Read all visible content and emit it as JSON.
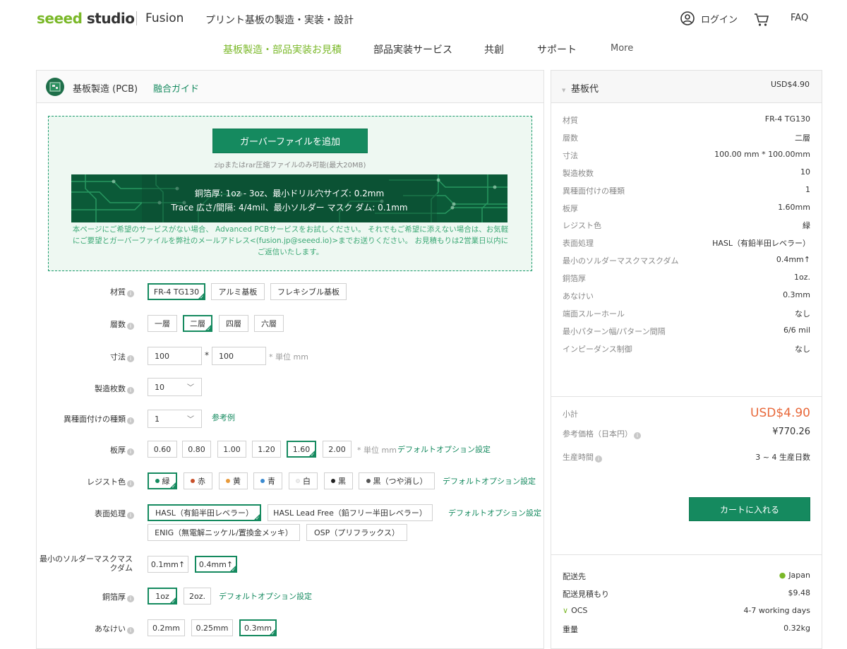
{
  "header": {
    "logo_seeed": "seeed",
    "logo_studio": "studio",
    "fusion": "Fusion",
    "tagline": "プリント基板の製造・実装・設計",
    "login": "ログイン",
    "faq": "FAQ"
  },
  "nav": {
    "items": [
      "基板製造・部品実装お見積",
      "部品実装サービス",
      "共創",
      "サポート",
      "More"
    ]
  },
  "form": {
    "title": "基板製造 (PCB)",
    "guide_link": "融合ガイド",
    "upload_button": "ガーバーファイルを追加",
    "upload_hint": "zipまたはrar圧縮ファイルのみ可能(最大20MB)",
    "banner_line1": "銅箔厚: 1oz - 3oz、最小ドリル穴サイズ: 0.2mm",
    "banner_line2": "Trace 広さ/間隔: 4/4mil、最小ソルダー マスク ダム: 0.1mm",
    "notice": "本ページにご希望のサービスがない場合、 Advanced PCBサービスをお試しください。 それでもご希望に添えない場合は、お気軽にご要望とガーバーファイルを弊社のメールアドレス<(fusion.jp@seeed.io)>までお送りください。 お見積もりは2営業日以内にご返信いたします。",
    "material": {
      "label": "材質",
      "options": [
        "FR-4 TG130",
        "アルミ基板",
        "フレキシブル基板"
      ]
    },
    "layers": {
      "label": "層数",
      "options": [
        "一層",
        "二層",
        "四層",
        "六層"
      ]
    },
    "size": {
      "label": "寸法",
      "w": "100",
      "h": "100",
      "sep": "*",
      "unit": "* 単位 mm"
    },
    "qty": {
      "label": "製造枚数",
      "value": "10"
    },
    "designs": {
      "label": "異種面付けの種類",
      "value": "1",
      "link": "参考例"
    },
    "thickness": {
      "label": "板厚",
      "options": [
        "0.60",
        "0.80",
        "1.00",
        "1.20",
        "1.60",
        "2.00"
      ],
      "unit": "* 単位 mm",
      "link": "デフォルトオプション設定"
    },
    "mask": {
      "label": "レジスト色",
      "options": [
        "緑",
        "赤",
        "黄",
        "青",
        "白",
        "黒",
        "黒（つや消し）"
      ],
      "link": "デフォルトオプション設定"
    },
    "finish": {
      "label": "表面処理",
      "options": [
        "HASL（有鉛半田レベラー）",
        "HASL Lead Free（鉛フリー半田レベラー）",
        "ENIG（無電解ニッケル/置換金メッキ）",
        "OSP（プリフラックス）"
      ],
      "link": "デフォルトオプション設定"
    },
    "dam": {
      "label_line1": "最小のソルダーマスクマス",
      "label_line2": "クダム",
      "options": [
        "0.1mm↑",
        "0.4mm↑"
      ]
    },
    "copper": {
      "label": "銅箔厚",
      "options": [
        "1oz",
        "2oz."
      ],
      "link": "デフォルトオプション設定"
    },
    "hole": {
      "label": "あなけい",
      "options": [
        "0.2mm",
        "0.25mm",
        "0.3mm"
      ]
    }
  },
  "summary": {
    "title": "基板代",
    "title_price": "USD$4.90",
    "rows": [
      {
        "k": "材質",
        "v": "FR-4 TG130"
      },
      {
        "k": "層数",
        "v": "二層"
      },
      {
        "k": "寸法",
        "v": "100.00 mm * 100.00mm"
      },
      {
        "k": "製造枚数",
        "v": "10"
      },
      {
        "k": "異種面付けの種類",
        "v": "1"
      },
      {
        "k": "板厚",
        "v": "1.60mm"
      },
      {
        "k": "レジスト色",
        "v": "緑"
      },
      {
        "k": "表面処理",
        "v": "HASL（有鉛半田レベラー）"
      },
      {
        "k": "最小のソルダーマスクマスクダム",
        "v": "0.4mm↑"
      },
      {
        "k": "銅箔厚",
        "v": "1oz."
      },
      {
        "k": "あなけい",
        "v": "0.3mm"
      },
      {
        "k": "端面スルーホール",
        "v": "なし"
      },
      {
        "k": "最小パターン幅/パターン間隔",
        "v": "6/6 mil"
      },
      {
        "k": "インピーダンス制御",
        "v": "なし"
      }
    ],
    "subtotal_label": "小計",
    "subtotal": "USD$4.90",
    "ref_label": "参考価格（日本円）",
    "ref_value": "¥770.26",
    "time_label": "生産時間",
    "time_value": "3 ~ 4 生産日数",
    "cart_button": "カートに入れる",
    "ship_label": "配送先",
    "ship_value": "Japan",
    "est_label": "配送見積もり",
    "est_value": "$9.48",
    "ocs_label": "OCS",
    "ocs_value": "4-7 working days",
    "weight_label": "重量",
    "weight_value": "0.32kg"
  },
  "colors": {
    "brand": "#7ab828",
    "accent": "#158a5f",
    "price": "#e8683a"
  }
}
